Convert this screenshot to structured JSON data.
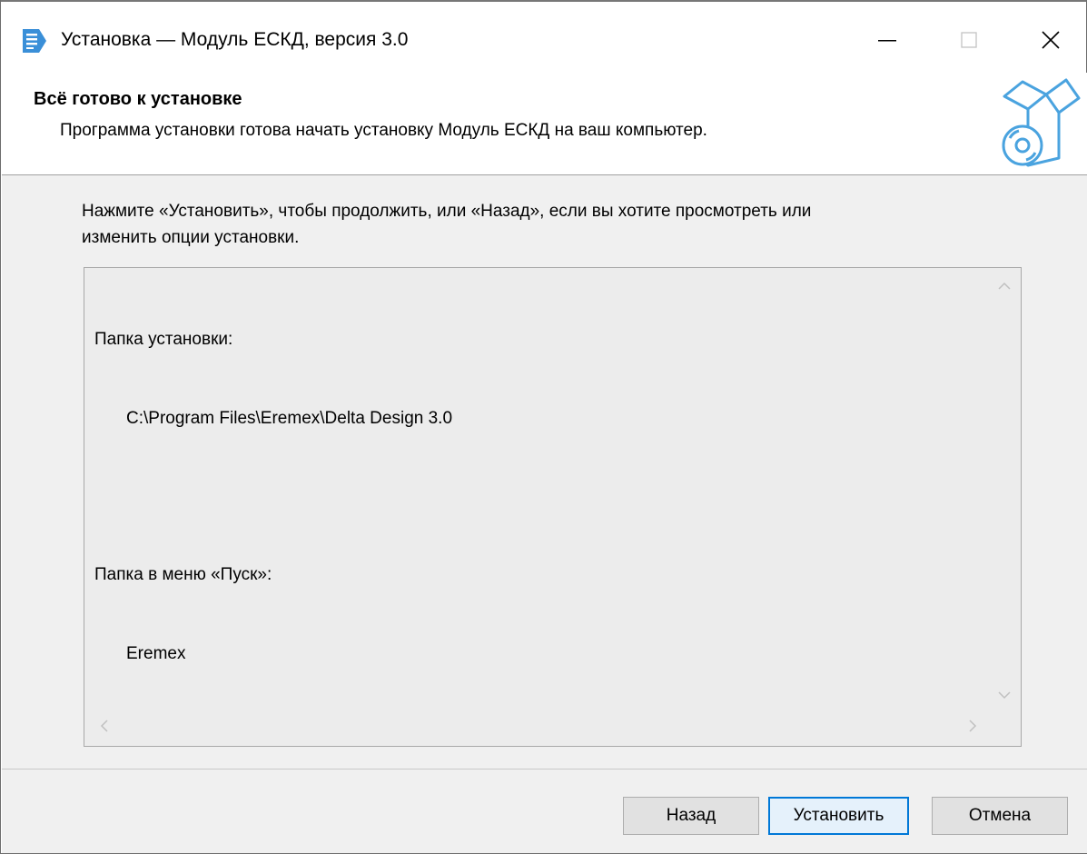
{
  "window": {
    "title": "Установка — Модуль ЕСКД, версия 3.0",
    "icons": {
      "app": "document-app-icon",
      "minimize": "minimize-icon",
      "maximize": "maximize-icon",
      "close": "close-icon"
    }
  },
  "header": {
    "title": "Всё готово к установке",
    "subtitle": "Программа установки готова начать установку Модуль ЕСКД на ваш компьютер.",
    "icon": "box-disc-icon"
  },
  "body": {
    "instruction_line1": "Нажмите «Установить», чтобы продолжить, или «Назад», если вы хотите просмотреть или",
    "instruction_line2": "изменить опции установки."
  },
  "summary": {
    "install_folder_label": "Папка установки:",
    "install_folder_value": "C:\\Program Files\\Eremex\\Delta Design 3.0",
    "start_menu_label": "Папка в меню «Пуск»:",
    "start_menu_value": "Eremex"
  },
  "buttons": {
    "back": "Назад",
    "install": "Установить",
    "cancel": "Отмена"
  },
  "colors": {
    "accent": "#0078d7",
    "app_icon": "#3a8fd8",
    "box_icon": "#4aa3df"
  }
}
